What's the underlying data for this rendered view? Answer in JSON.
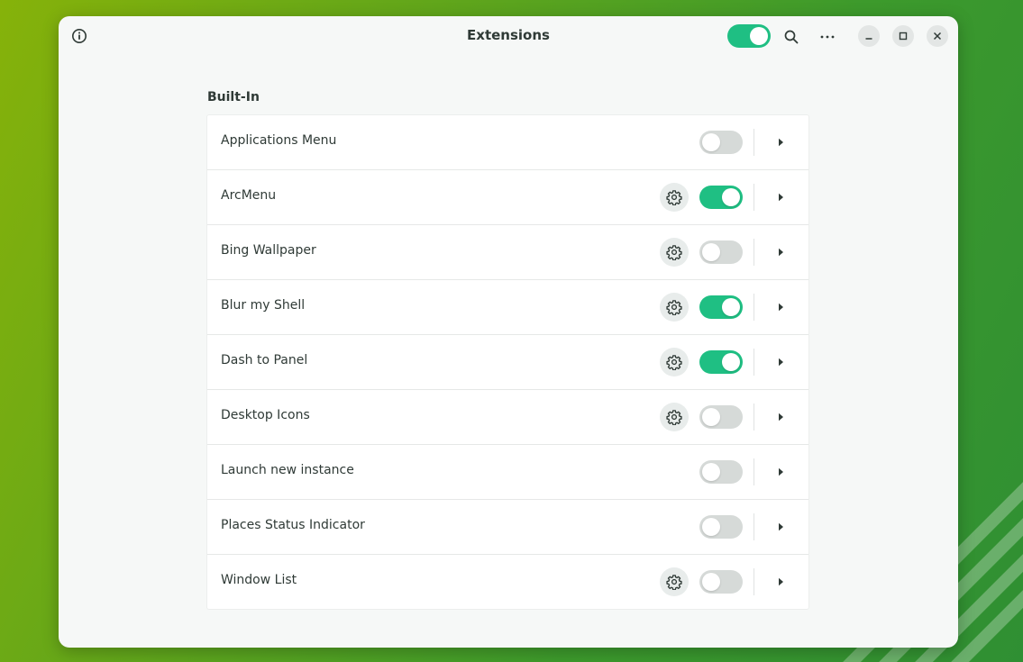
{
  "window": {
    "title": "Extensions",
    "master_toggle_on": true
  },
  "icons": {
    "info": "info-icon",
    "search": "search-icon",
    "menu": "more-horizontal-icon",
    "minimize": "minimize-icon",
    "maximize": "maximize-icon",
    "close": "close-icon",
    "settings": "gear-icon",
    "expand": "chevron-right-icon"
  },
  "colors": {
    "accent": "#1fbf83",
    "toggle_off": "#d6dad8",
    "text": "#2f3a36"
  },
  "section": {
    "title": "Built-In",
    "extensions": [
      {
        "name": "Applications Menu",
        "has_settings": false,
        "enabled": false
      },
      {
        "name": "ArcMenu",
        "has_settings": true,
        "enabled": true
      },
      {
        "name": "Bing Wallpaper",
        "has_settings": true,
        "enabled": false
      },
      {
        "name": "Blur my Shell",
        "has_settings": true,
        "enabled": true
      },
      {
        "name": "Dash to Panel",
        "has_settings": true,
        "enabled": true
      },
      {
        "name": "Desktop Icons",
        "has_settings": true,
        "enabled": false
      },
      {
        "name": "Launch new instance",
        "has_settings": false,
        "enabled": false
      },
      {
        "name": "Places Status Indicator",
        "has_settings": false,
        "enabled": false
      },
      {
        "name": "Window List",
        "has_settings": true,
        "enabled": false
      }
    ]
  }
}
